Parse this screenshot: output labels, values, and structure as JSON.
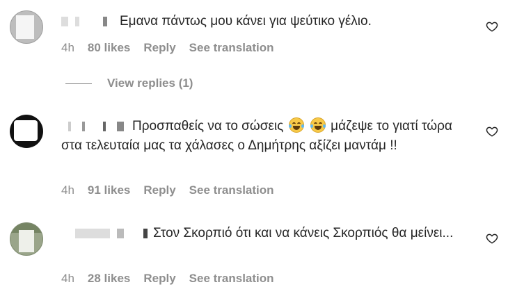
{
  "comments": [
    {
      "text": "Εμανα πάντως μου κάνει για ψεύτικο γέλιο.",
      "time": "4h",
      "likes": "80 likes",
      "reply": "Reply",
      "translate": "See translation",
      "view_replies": "View replies (1)"
    },
    {
      "text_before": "Προσπαθείς να το σώσεις",
      "emoji": "😂😂",
      "text_after": "μάζεψε το γιατί τώρα στα τελευταία μας τα χάλασες ο Δημήτρης αξίζει μαντάμ !!",
      "time": "4h",
      "likes": "91 likes",
      "reply": "Reply",
      "translate": "See translation"
    },
    {
      "text": "Στον Σκορπιό ότι και να κάνεις Σκορπιός θα μείνει...",
      "time": "4h",
      "likes": "28 likes",
      "reply": "Reply",
      "translate": "See translation"
    }
  ]
}
